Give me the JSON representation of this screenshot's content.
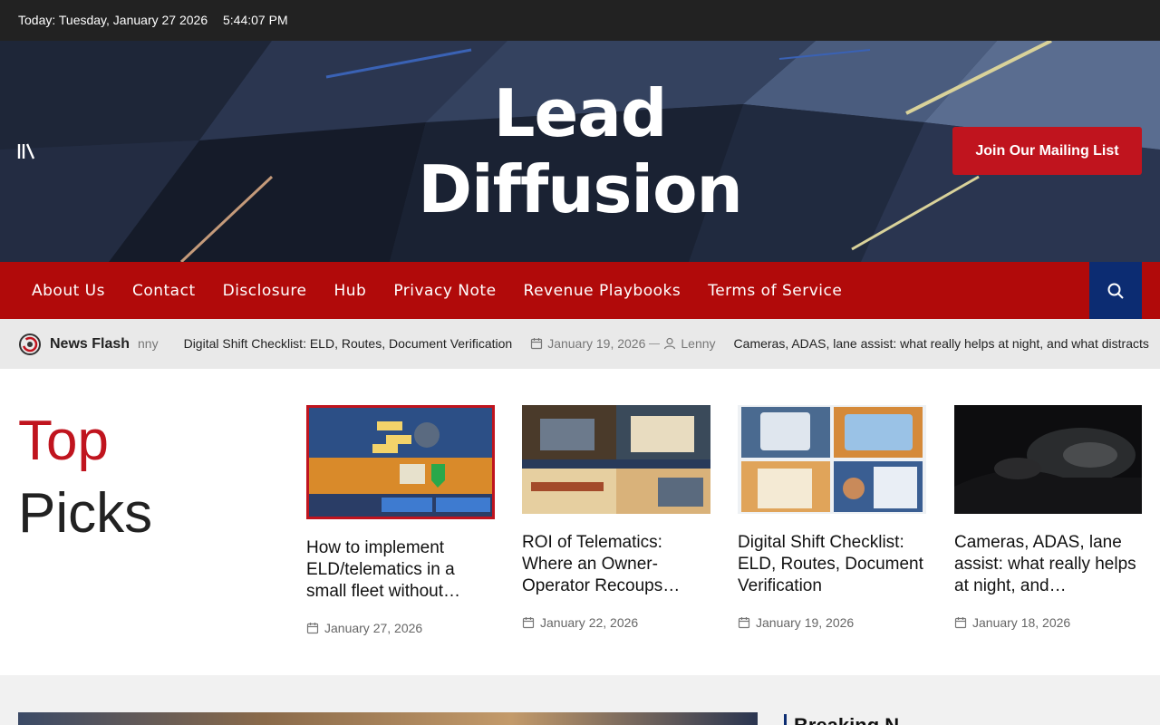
{
  "topbar": {
    "date": "Today: Tuesday, January 27 2026",
    "time": "5:44:07 PM"
  },
  "header": {
    "title": "Lead Diffusion",
    "join_button": "Join Our Mailing List"
  },
  "nav": {
    "items": [
      "About Us",
      "Contact",
      "Disclosure",
      "Hub",
      "Privacy Note",
      "Revenue Playbooks",
      "Terms of Service"
    ]
  },
  "news_flash": {
    "label": "News Flash",
    "author_fragment": "nny",
    "items": [
      {
        "title": "Digital Shift Checklist: ELD, Routes, Document Verification",
        "date": "January 19, 2026",
        "author": "Lenny"
      },
      {
        "title": "Cameras, ADAS, lane assist: what really helps at night, and what distracts"
      }
    ]
  },
  "top_picks": {
    "title_first": "Top",
    "title_second": "Picks",
    "cards": [
      {
        "title": "How to implement ELD/telematics in a small fleet without…",
        "date": "January 27, 2026"
      },
      {
        "title": "ROI of Telematics: Where an Owner-Operator Recoups…",
        "date": "January 22, 2026"
      },
      {
        "title": "Digital Shift Checklist: ELD, Routes, Document Verification",
        "date": "January 19, 2026"
      },
      {
        "title": "Cameras, ADAS, lane assist: what really helps at night, and…",
        "date": "January 18, 2026"
      }
    ]
  },
  "lower": {
    "section_title": "Breaking N"
  },
  "colors": {
    "brand_red": "#b10a0a",
    "accent_red": "#c0141e",
    "navy": "#0c2c72",
    "topbar": "#222222"
  }
}
